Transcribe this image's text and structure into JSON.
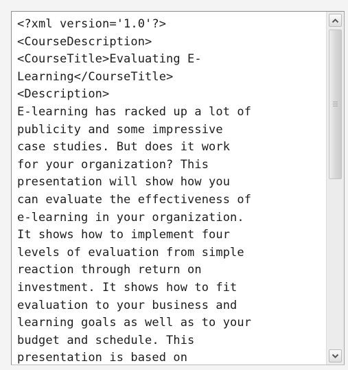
{
  "textarea": {
    "lines": [
      "<?xml version='1.0'?>",
      "<CourseDescription>",
      "<CourseTitle>Evaluating E-",
      "Learning</CourseTitle>",
      "<Description>",
      "E-learning has racked up a lot of",
      "publicity and some impressive",
      "case studies. But does it work",
      "for your organization? This",
      "presentation will show how you",
      "can evaluate the effectiveness of",
      "e-learning in your organization.",
      "It shows how to implement four",
      "levels of evaluation from simple",
      "reaction through return on",
      "investment. It shows how to fit",
      "evaluation to your business and",
      "learning goals as well as to your",
      "budget and schedule. This",
      "presentation is based on"
    ]
  },
  "scrollbar": {
    "up_icon": "chevron-up-icon",
    "down_icon": "chevron-down-icon",
    "scroll_position": 0
  },
  "colors": {
    "text": "#1c1c1c",
    "background": "#ffffff",
    "frame": "#8d8d8d",
    "scrollbar_track": "#ececec"
  }
}
